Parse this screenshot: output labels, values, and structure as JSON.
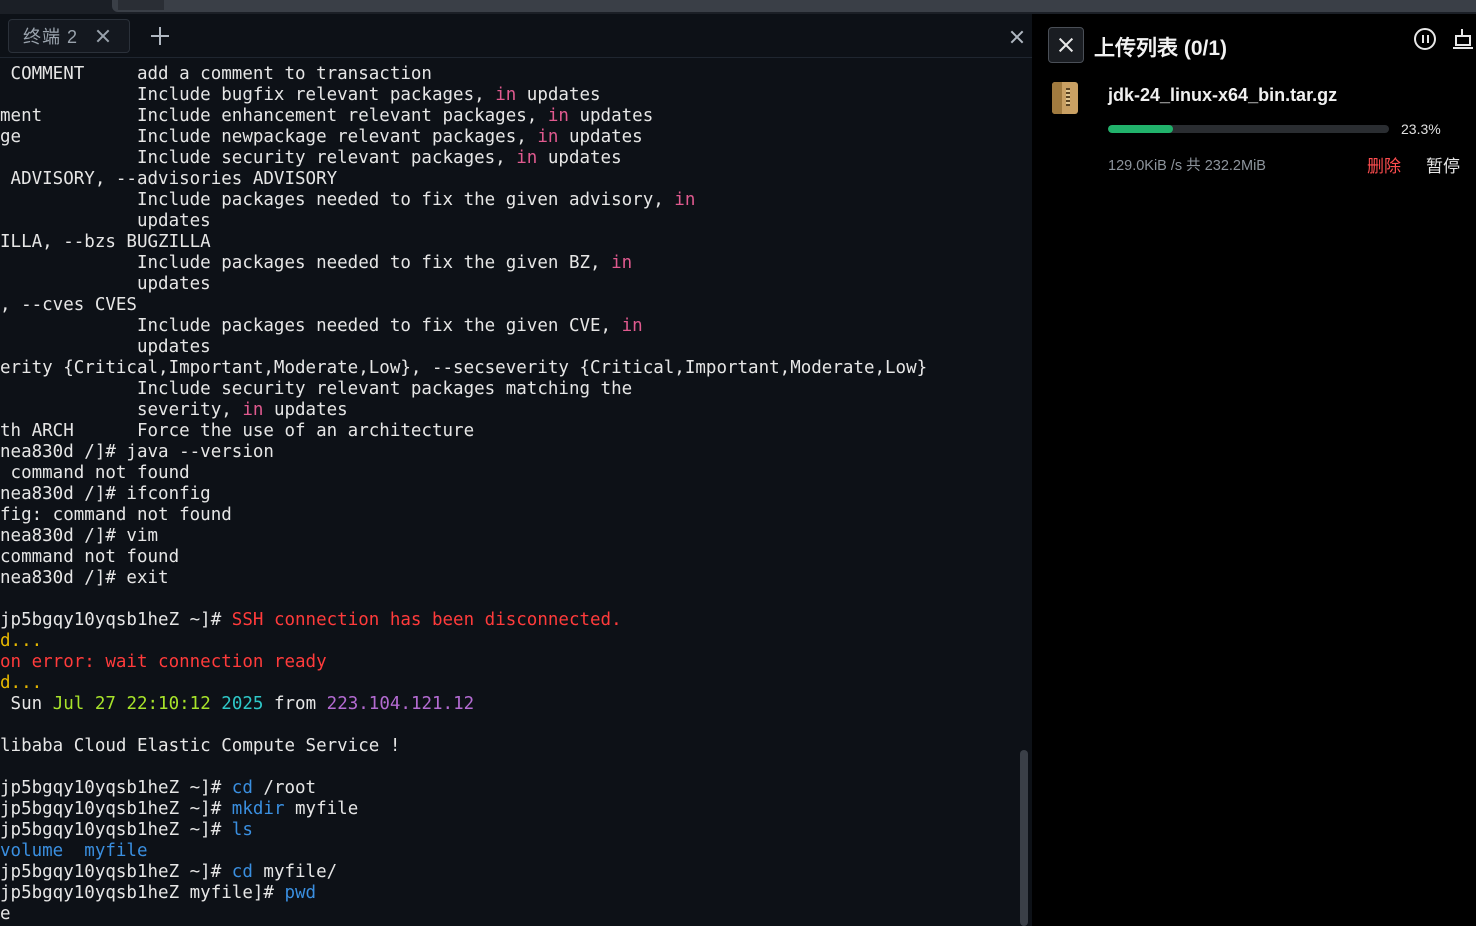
{
  "terminal": {
    "tab_label": "终端 2",
    "lines": [
      [
        {
          "t": " COMMENT     add a comment to transaction"
        }
      ],
      [
        {
          "t": "             Include bugfix relevant packages, "
        },
        {
          "t": "in",
          "c": "kw"
        },
        {
          "t": " updates"
        }
      ],
      [
        {
          "t": "ment         Include enhancement relevant packages, "
        },
        {
          "t": "in",
          "c": "kw"
        },
        {
          "t": " updates"
        }
      ],
      [
        {
          "t": "ge           Include newpackage relevant packages, "
        },
        {
          "t": "in",
          "c": "kw"
        },
        {
          "t": " updates"
        }
      ],
      [
        {
          "t": "             Include security relevant packages, "
        },
        {
          "t": "in",
          "c": "kw"
        },
        {
          "t": " updates"
        }
      ],
      [
        {
          "t": " ADVISORY, --advisories ADVISORY"
        }
      ],
      [
        {
          "t": "             Include packages needed to fix the given advisory, "
        },
        {
          "t": "in",
          "c": "kw"
        }
      ],
      [
        {
          "t": "             updates"
        }
      ],
      [
        {
          "t": "ILLA, --bzs BUGZILLA"
        }
      ],
      [
        {
          "t": "             Include packages needed to fix the given BZ, "
        },
        {
          "t": "in",
          "c": "kw"
        }
      ],
      [
        {
          "t": "             updates"
        }
      ],
      [
        {
          "t": ", --cves CVES"
        }
      ],
      [
        {
          "t": "             Include packages needed to fix the given CVE, "
        },
        {
          "t": "in",
          "c": "kw"
        }
      ],
      [
        {
          "t": "             updates"
        }
      ],
      [
        {
          "t": "erity {Critical,Important,Moderate,Low}, --secseverity {Critical,Important,Moderate,Low}"
        }
      ],
      [
        {
          "t": "             Include security relevant packages matching the"
        }
      ],
      [
        {
          "t": "             severity, "
        },
        {
          "t": "in",
          "c": "kw"
        },
        {
          "t": " updates"
        }
      ],
      [
        {
          "t": "th ARCH      Force the use of an architecture"
        }
      ],
      [
        {
          "t": "nea830d /]# java --version"
        }
      ],
      [
        {
          "t": " command not found"
        }
      ],
      [
        {
          "t": "nea830d /]# ifconfig"
        }
      ],
      [
        {
          "t": "fig: command not found"
        }
      ],
      [
        {
          "t": "nea830d /]# vim"
        }
      ],
      [
        {
          "t": "command not found"
        }
      ],
      [
        {
          "t": "nea830d /]# exit"
        }
      ],
      [
        {
          "t": ""
        }
      ],
      [
        {
          "t": "jp5bgqy10yqsb1heZ ~]# "
        },
        {
          "t": "SSH connection has been disconnected.",
          "c": "red"
        }
      ],
      [
        {
          "t": "d...",
          "c": "yellow"
        }
      ],
      [
        {
          "t": "on error: wait connection ready",
          "c": "red"
        }
      ],
      [
        {
          "t": "d...",
          "c": "yellow"
        }
      ],
      [
        {
          "t": " Sun "
        },
        {
          "t": "Jul 27 22:10:12",
          "c": "green"
        },
        {
          "t": " "
        },
        {
          "t": "2025",
          "c": "cyan"
        },
        {
          "t": " from "
        },
        {
          "t": "223.104.121.12",
          "c": "purple"
        }
      ],
      [
        {
          "t": ""
        }
      ],
      [
        {
          "t": "libaba Cloud Elastic Compute Service !"
        }
      ],
      [
        {
          "t": ""
        }
      ],
      [
        {
          "t": "jp5bgqy10yqsb1heZ ~]# "
        },
        {
          "t": "cd",
          "c": "blue"
        },
        {
          "t": " /root"
        }
      ],
      [
        {
          "t": "jp5bgqy10yqsb1heZ ~]# "
        },
        {
          "t": "mkdir",
          "c": "blue"
        },
        {
          "t": " myfile"
        }
      ],
      [
        {
          "t": "jp5bgqy10yqsb1heZ ~]# "
        },
        {
          "t": "ls",
          "c": "blue"
        }
      ],
      [
        {
          "t": "volume  myfile",
          "c": "blue"
        }
      ],
      [
        {
          "t": "jp5bgqy10yqsb1heZ ~]# "
        },
        {
          "t": "cd",
          "c": "blue"
        },
        {
          "t": " myfile/"
        }
      ],
      [
        {
          "t": "jp5bgqy10yqsb1heZ myfile]# "
        },
        {
          "t": "pwd",
          "c": "blue"
        }
      ],
      [
        {
          "t": "e"
        }
      ]
    ]
  },
  "upload_panel": {
    "title": "上传列表 (0/1)",
    "file_name": "jdk-24_linux-x64_bin.tar.gz",
    "progress": 0.233,
    "progress_label": "23.3%",
    "speed": "129.0KiB /s  共 232.2MiB",
    "delete_label": "删除",
    "pause_label": "暂停"
  },
  "colors": {
    "progress": "#21b26b",
    "error": "#ff3b3b",
    "delete": "#ff4d4f",
    "keyword": "#e05a8f",
    "command": "#3a8fe0"
  },
  "icons": [
    "tab-close-icon",
    "add-tab-icon",
    "terminal-close-icon",
    "close-icon",
    "pause-all-icon",
    "server-icon",
    "archive-file-icon"
  ]
}
